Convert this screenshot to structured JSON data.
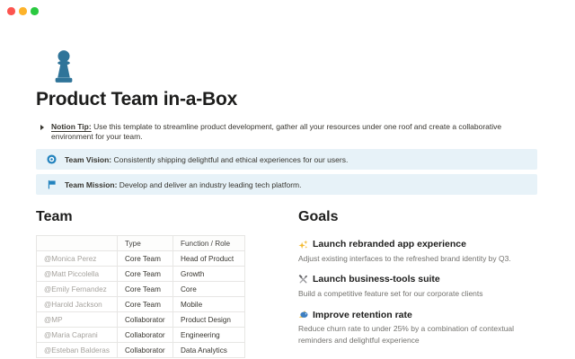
{
  "window": {
    "controls": [
      {
        "name": "close",
        "color": "#FC544F"
      },
      {
        "name": "minimize",
        "color": "#FDB32B"
      },
      {
        "name": "zoom",
        "color": "#2AC940"
      }
    ]
  },
  "page": {
    "icon": "pawn-icon",
    "icon_color": "#2F7499",
    "title": "Product Team in-a-Box",
    "tip": {
      "toggle_icon": "triangle-right-icon",
      "label": "Notion Tip:",
      "text": "Use this template to streamline product development, gather all your resources under one roof and create a collaborative environment for your team."
    },
    "callouts": [
      {
        "icon": "compass-icon",
        "label": "Team Vision:",
        "text": "Consistently shipping delightful and ethical experiences for our users.",
        "background": "#E7F2F8"
      },
      {
        "icon": "flag-icon",
        "label": "Team Mission:",
        "text": "Develop and deliver an industry leading tech platform.",
        "background": "#E7F2F8"
      }
    ]
  },
  "team": {
    "heading": "Team",
    "table": {
      "columns": [
        "",
        "Type",
        "Function / Role"
      ],
      "rows": [
        {
          "name": "@Monica Perez",
          "type": "Core Team",
          "role": "Head of Product"
        },
        {
          "name": "@Matt Piccolella",
          "type": "Core Team",
          "role": "Growth"
        },
        {
          "name": "@Emily Fernandez",
          "type": "Core Team",
          "role": "Core"
        },
        {
          "name": "@Harold Jackson",
          "type": "Core Team",
          "role": "Mobile"
        },
        {
          "name": "@MP",
          "type": "Collaborator",
          "role": "Product Design"
        },
        {
          "name": "@Maria Caprani",
          "type": "Collaborator",
          "role": "Engineering"
        },
        {
          "name": "@Esteban Balderas",
          "type": "Collaborator",
          "role": "Data Analytics"
        }
      ]
    }
  },
  "goals": {
    "heading": "Goals",
    "items": [
      {
        "icon": "sparkles-icon",
        "title": "Launch rebranded app experience",
        "description": "Adjust existing interfaces to the refreshed brand identity by Q3."
      },
      {
        "icon": "hammer-and-wrench-icon",
        "title": "Launch business-tools suite",
        "description": "Build a competitive feature set for our corporate clients"
      },
      {
        "icon": "fish-icon",
        "title": "Improve retention rate",
        "description": "Reduce churn rate to under 25% by a combination of contextual reminders and delightful experience"
      }
    ]
  },
  "colors": {
    "accent_blue": "#2F7499",
    "callout_icon_blue": "#2383BE",
    "callout_background": "#E7F2F8",
    "text_primary": "#37352F",
    "text_secondary": "#73726E",
    "mention_gray": "#A5A29D",
    "table_border": "#E7E6E4"
  }
}
